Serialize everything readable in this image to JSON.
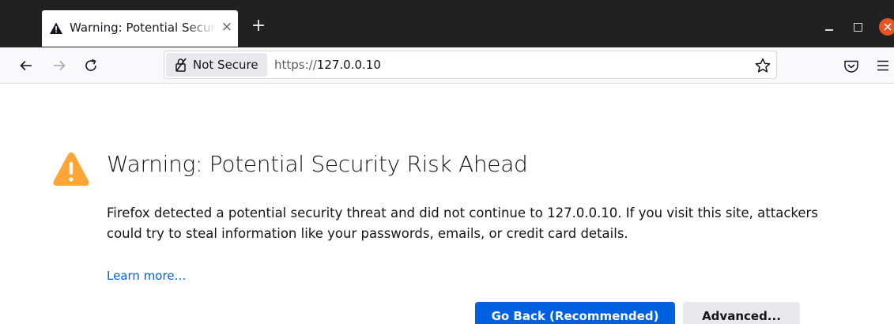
{
  "tab": {
    "title": "Warning: Potential Security Risk Ahead",
    "close_glyph": "×"
  },
  "newtab_glyph": "+",
  "toolbar": {
    "identity_label": "Not Secure",
    "url_scheme": "https://",
    "url_host": "127.0.0.10"
  },
  "page": {
    "title": "Warning: Potential Security Risk Ahead",
    "description": "Firefox detected a potential security threat and did not continue to 127.0.0.10. If you visit this site, attackers could try to steal information like your passwords, emails, or credit card details.",
    "learn_more": "Learn more…",
    "go_back_label": "Go Back (Recommended)",
    "advanced_label": "Advanced..."
  },
  "colors": {
    "warning_orange": "#ffa436",
    "primary_blue": "#0061e0",
    "close_red": "#e95420"
  },
  "icons": [
    "warning-icon",
    "close-icon",
    "plus-icon",
    "minimize-icon",
    "maximize-icon",
    "window-close-icon",
    "back-arrow-icon",
    "forward-arrow-icon",
    "reload-icon",
    "insecure-lock-icon",
    "bookmark-star-icon",
    "pocket-icon",
    "hamburger-menu-icon"
  ]
}
